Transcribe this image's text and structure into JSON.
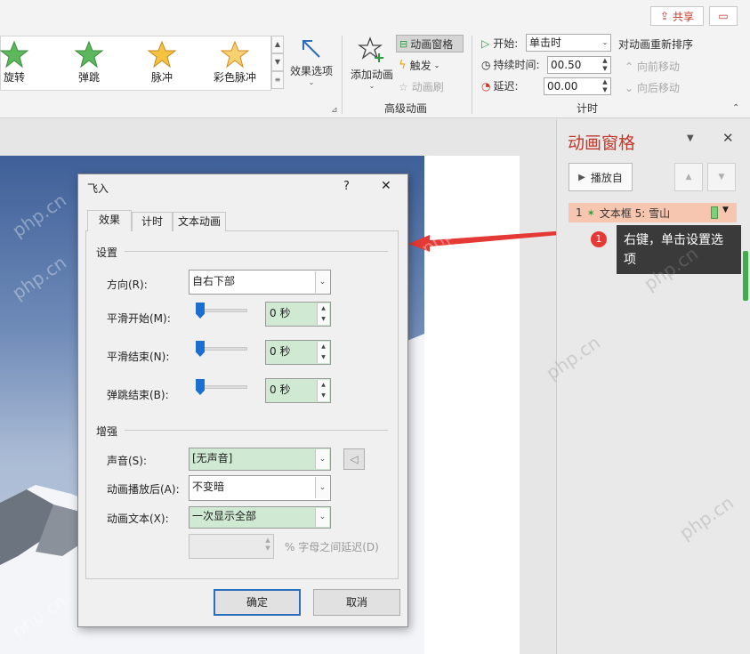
{
  "ribbon": {
    "share_label": "共享",
    "gallery": [
      "旋转",
      "弹跳",
      "脉冲",
      "彩色脉冲"
    ],
    "effect_options": "效果选项",
    "add_animation": "添加动画",
    "animation_pane_btn": "动画窗格",
    "trigger": "触发",
    "painter": "动画刷",
    "advanced_group": "高级动画",
    "start_label": "开始:",
    "start_value": "单击时",
    "duration_label": "持续时间:",
    "duration_value": "00.50",
    "delay_label": "延迟:",
    "delay_value": "00.00",
    "reorder_title": "对动画重新排序",
    "move_earlier": "向前移动",
    "move_later": "向后移动",
    "timing_group": "计时"
  },
  "panel": {
    "title": "动画窗格",
    "play_from": "播放自",
    "item_number": "1",
    "item_label": "文本框 5: 雪山",
    "tooltip_badge": "1",
    "tooltip_text": "右键，单击设置选项"
  },
  "dialog": {
    "title": "飞入",
    "help": "?",
    "close": "✕",
    "tabs": [
      "效果",
      "计时",
      "文本动画"
    ],
    "settings_group": "设置",
    "direction_label": "方向(R):",
    "direction_value": "自右下部",
    "smooth_start_label": "平滑开始(M):",
    "smooth_start_value": "0 秒",
    "smooth_end_label": "平滑结束(N):",
    "smooth_end_value": "0 秒",
    "bounce_end_label": "弹跳结束(B):",
    "bounce_end_value": "0 秒",
    "enhance_group": "增强",
    "sound_label": "声音(S):",
    "sound_value": "[无声音]",
    "after_label": "动画播放后(A):",
    "after_value": "不变暗",
    "text_label": "动画文本(X):",
    "text_value": "一次显示全部",
    "delay_between": "% 字母之间延迟(D)",
    "ok": "确定",
    "cancel": "取消"
  },
  "colors": {
    "accent_red": "#c0392b",
    "selection": "#f7c6b0",
    "green_field": "#cfe9d2",
    "slider_thumb": "#1a6fd0"
  },
  "watermark": "php.cn"
}
